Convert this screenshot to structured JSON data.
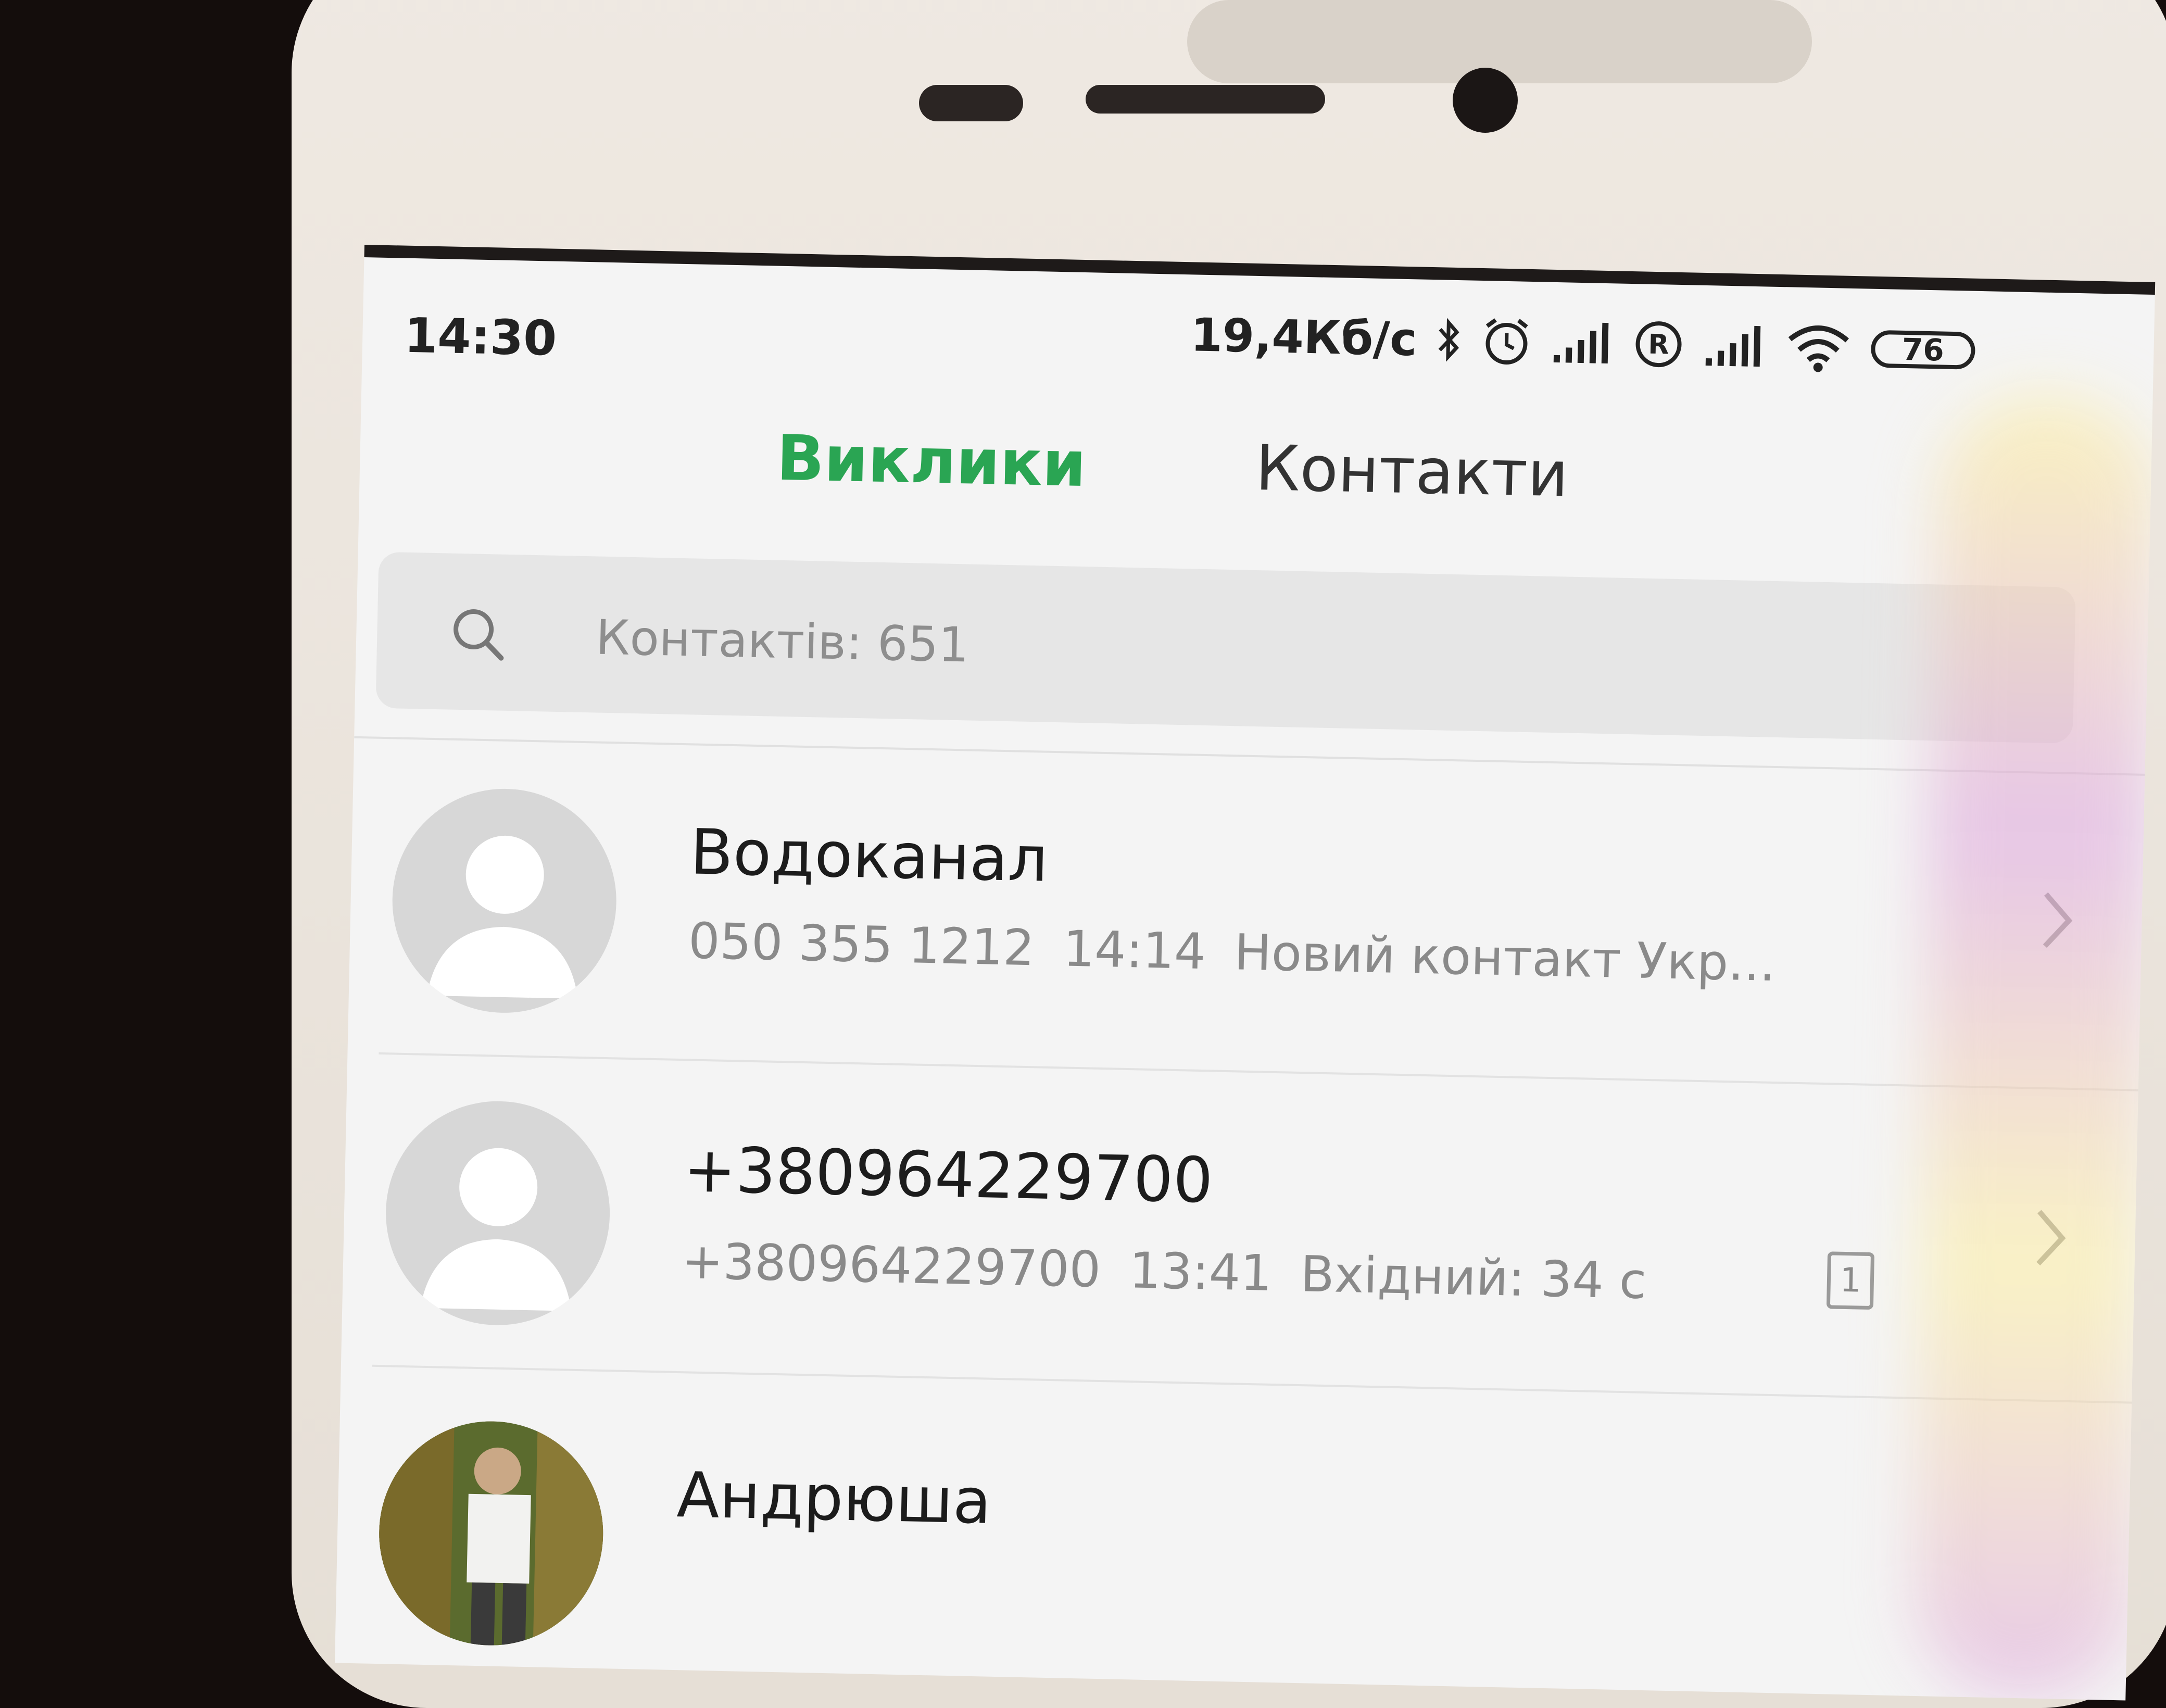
{
  "status_bar": {
    "time": "14:30",
    "net_speed": "19,4Кб/с",
    "battery": "76",
    "icons": [
      "bluetooth-icon",
      "alarm-icon",
      "signal-icon",
      "roaming-icon",
      "signal-icon",
      "wifi-icon",
      "battery-icon"
    ]
  },
  "tabs": {
    "calls": "Виклики",
    "contacts": "Контакти",
    "active": "calls",
    "active_color": "#2aa553"
  },
  "search": {
    "placeholder": "Контактів: 651"
  },
  "calls": [
    {
      "name": "Водоканал",
      "number": "050 355 1212",
      "time": "14:14",
      "info": "Новий контакт  Укр..."
    },
    {
      "name": "+380964229700",
      "number": "+380964229700",
      "time": "13:41",
      "info": "Вхідний: 34 с",
      "sim": "1"
    },
    {
      "name": "Андрюша"
    }
  ]
}
